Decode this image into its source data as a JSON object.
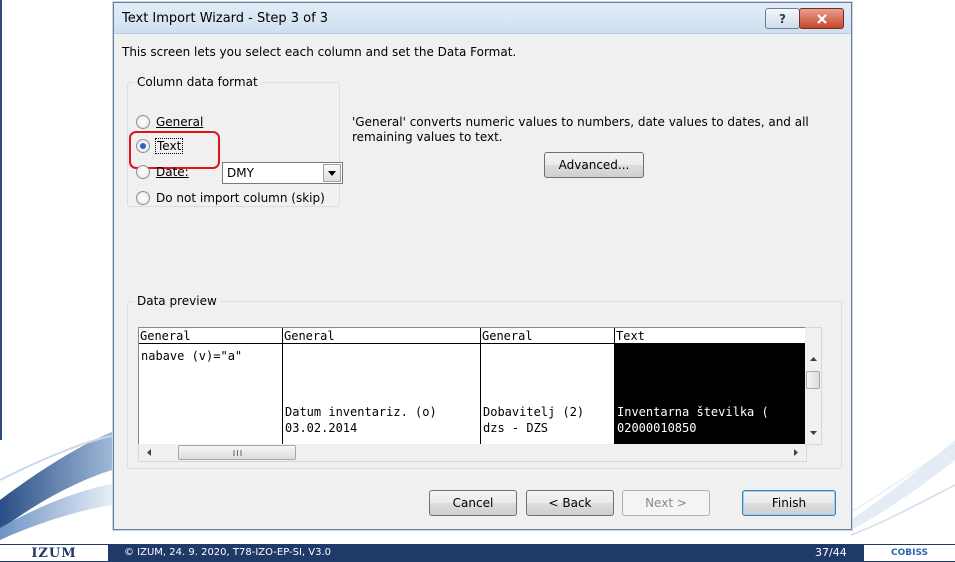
{
  "dialog": {
    "title": "Text Import Wizard - Step 3 of 3",
    "intro": "This screen lets you select each column and set the Data Format."
  },
  "format_group": {
    "legend": "Column data format",
    "options": [
      {
        "label": "General",
        "selected": false
      },
      {
        "label": "Text",
        "selected": true
      },
      {
        "label": "Date:",
        "selected": false
      },
      {
        "label": "Do not import column (skip)",
        "selected": false
      }
    ],
    "date_value": "DMY"
  },
  "description": "'General' converts numeric values to numbers, date values to dates, and all remaining values to text.",
  "advanced_label": "Advanced...",
  "preview": {
    "legend": "Data preview",
    "columns": [
      {
        "header": "General",
        "rows": [
          "nabave (v)=\"a\"",
          "",
          "",
          ""
        ]
      },
      {
        "header": "General",
        "rows": [
          "",
          "",
          "Datum inventariz. (o)",
          "03.02.2014"
        ]
      },
      {
        "header": "General",
        "rows": [
          "",
          "",
          "Dobavitelj (2)",
          "dzs - DZS"
        ]
      },
      {
        "header": "Text",
        "rows": [
          "",
          "",
          "Inventarna številka (",
          "02000010850"
        ]
      }
    ]
  },
  "buttons": {
    "cancel": "Cancel",
    "back": "< Back",
    "next": "Next >",
    "finish": "Finish"
  },
  "footer": {
    "logo": "IZUM",
    "text": "© IZUM, 24. 9. 2020, T78-IZO-EP-SI, V3.0",
    "page": "37/44",
    "brand": "COBISS"
  },
  "colors": {
    "accent": "#2a63c9",
    "highlight": "#e2141b",
    "footer_bg": "#1f3a68"
  }
}
